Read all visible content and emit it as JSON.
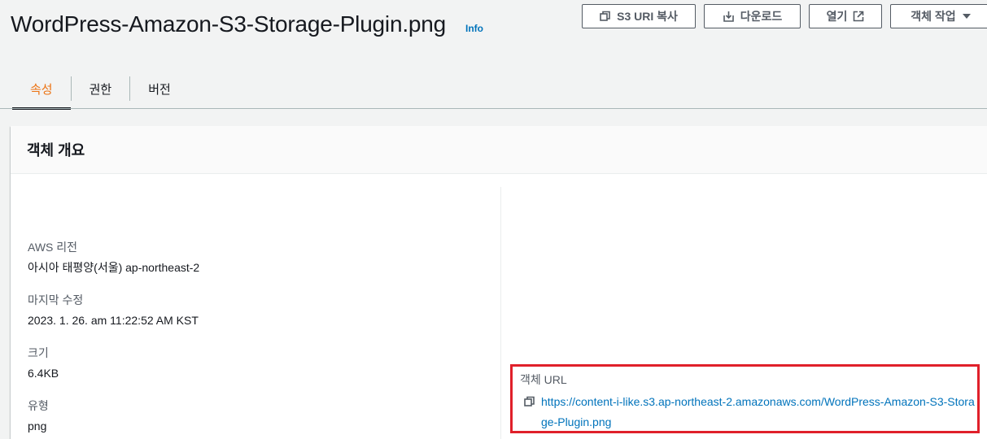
{
  "header": {
    "title": "WordPress-Amazon-S3-Storage-Plugin.png",
    "info_label": "Info",
    "buttons": {
      "copy_uri": "S3 URI 복사",
      "download": "다운로드",
      "open": "열기",
      "actions": "객체 작업"
    }
  },
  "tabs": [
    {
      "label": "속성",
      "active": true
    },
    {
      "label": "권한",
      "active": false
    },
    {
      "label": "버전",
      "active": false
    }
  ],
  "overview": {
    "title": "객체 개요",
    "fields": {
      "region": {
        "label": "AWS 리전",
        "value": "아시아 태평양(서울) ap-northeast-2"
      },
      "last_modified": {
        "label": "마지막 수정",
        "value": "2023. 1. 26. am 11:22:52 AM KST"
      },
      "size": {
        "label": "크기",
        "value": "6.4KB"
      },
      "type": {
        "label": "유형",
        "value": "png"
      }
    },
    "object_url": {
      "label": "객체 URL",
      "value": "https://content-i-like.s3.ap-northeast-2.amazonaws.com/WordPress-Amazon-S3-Storage-Plugin.png"
    }
  },
  "colors": {
    "accent": "#ec7211",
    "link": "#0073bb",
    "highlight": "#e0202a"
  },
  "icons": [
    "copy-icon",
    "download-icon",
    "external-link-icon",
    "caret-down-icon"
  ]
}
